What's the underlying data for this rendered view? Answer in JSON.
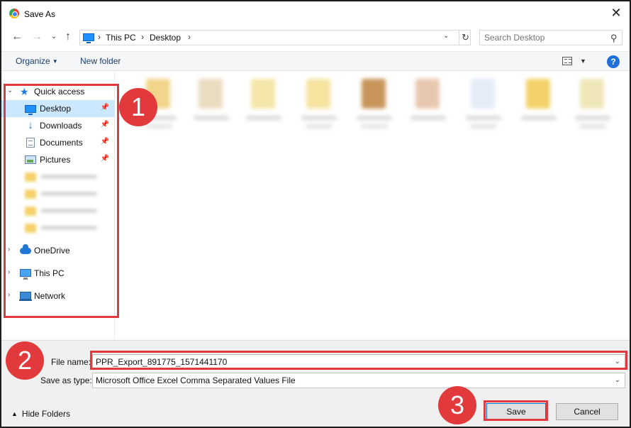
{
  "window": {
    "title": "Save As",
    "close_glyph": "✕"
  },
  "address_bar": {
    "crumbs": [
      "This PC",
      "Desktop"
    ],
    "separator": "›"
  },
  "search": {
    "placeholder": "Search Desktop"
  },
  "toolbar": {
    "organize_label": "Organize",
    "new_folder_label": "New folder",
    "help_label": "?"
  },
  "nav_pane": {
    "quick_access_label": "Quick access",
    "pinned": [
      {
        "label": "Desktop",
        "icon": "desktop-icon",
        "selected": true
      },
      {
        "label": "Downloads",
        "icon": "downloads-icon"
      },
      {
        "label": "Documents",
        "icon": "documents-icon"
      },
      {
        "label": "Pictures",
        "icon": "pictures-icon"
      }
    ],
    "onedrive_label": "OneDrive",
    "this_pc_label": "This PC",
    "network_label": "Network"
  },
  "form": {
    "file_name_label": "File name:",
    "file_name_value": "PPR_Export_891775_1571441170",
    "save_as_type_label": "Save as type:",
    "save_as_type_value": "Microsoft Office Excel Comma Separated Values File",
    "hide_folders_label": "Hide Folders",
    "save_label": "Save",
    "cancel_label": "Cancel"
  },
  "annotations": {
    "step_1": "1",
    "step_2": "2",
    "step_3": "3",
    "color": "#e23a3c"
  }
}
